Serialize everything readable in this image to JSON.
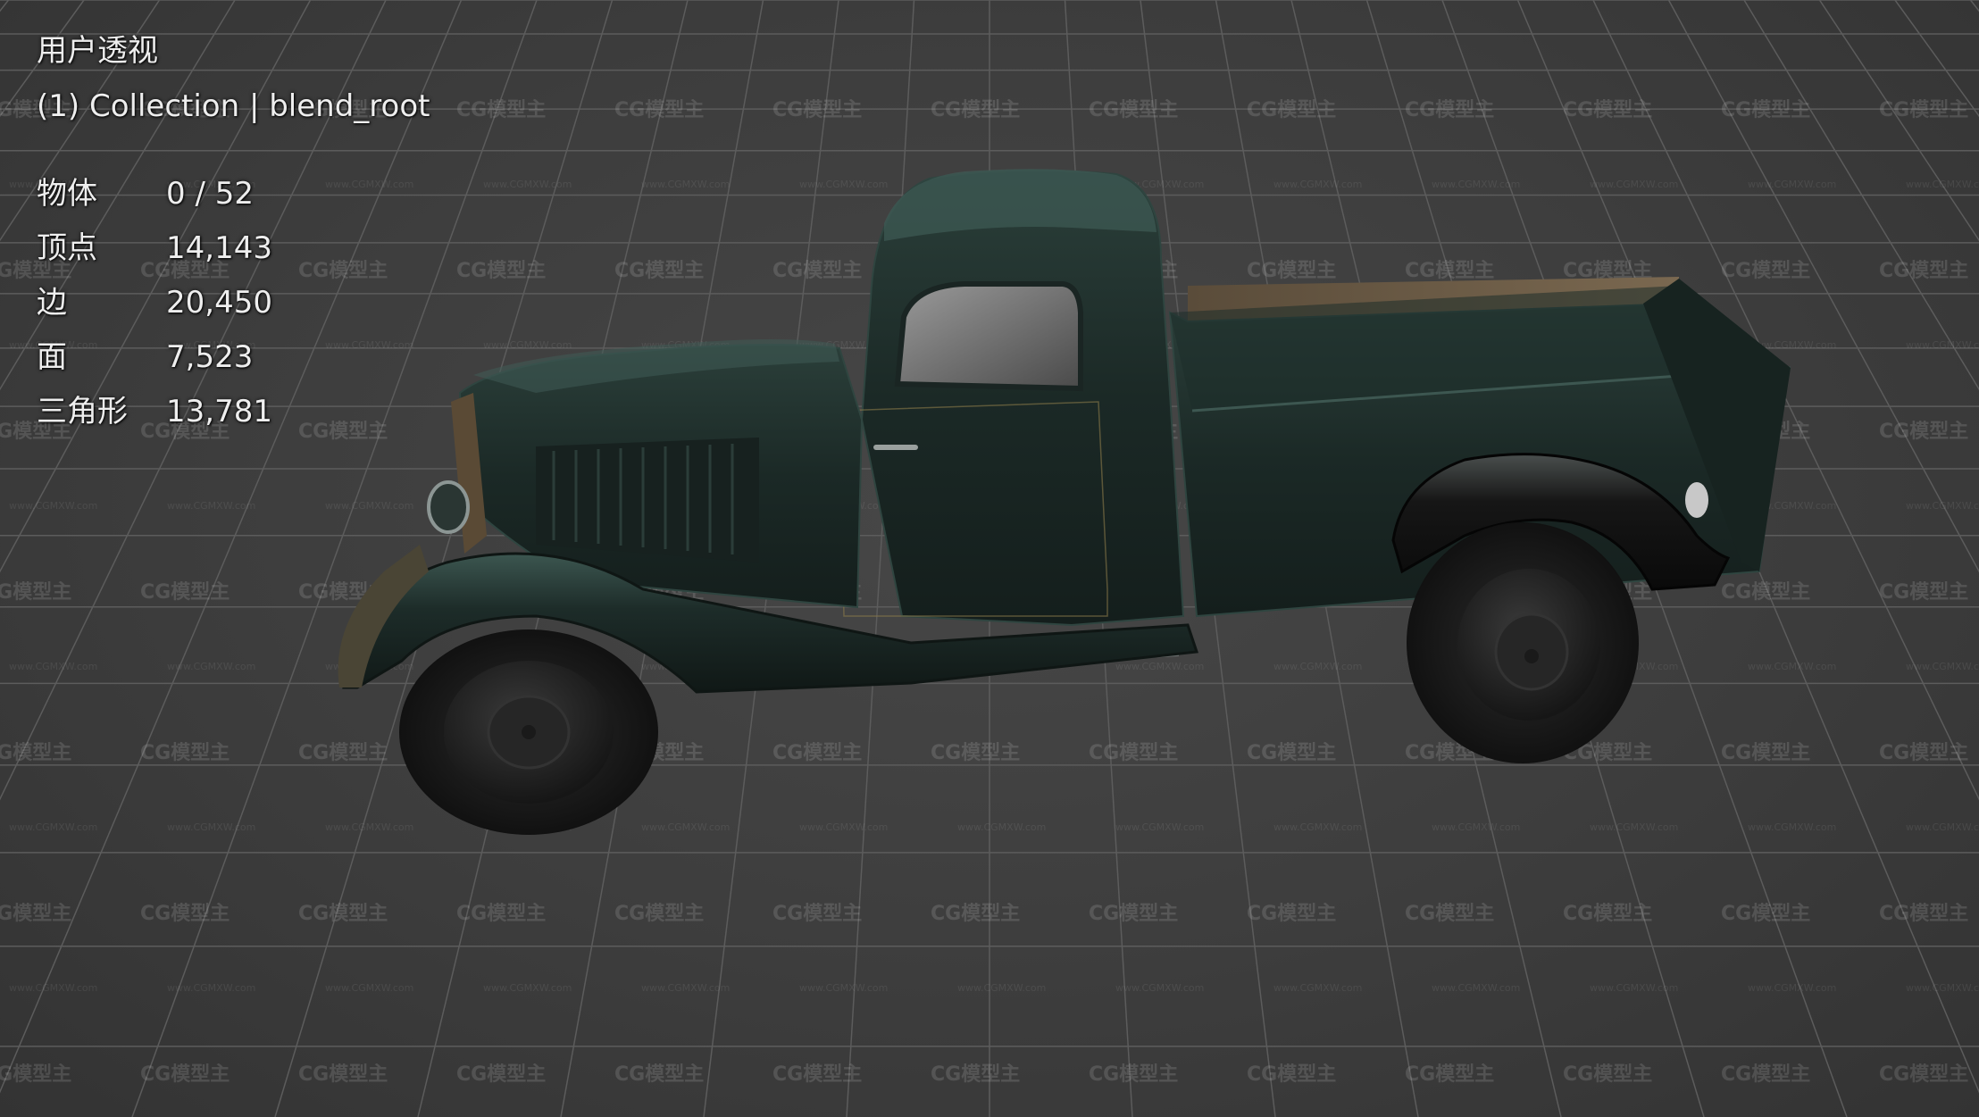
{
  "viewport": {
    "view_name": "用户透视",
    "collection_info": "(1) Collection | blend_root"
  },
  "stats": [
    {
      "label": "物体",
      "value": "0 / 52"
    },
    {
      "label": "顶点",
      "value": "14,143"
    },
    {
      "label": "边",
      "value": "20,450"
    },
    {
      "label": "面",
      "value": "7,523"
    },
    {
      "label": "三角形",
      "value": "13,781"
    }
  ],
  "watermark": {
    "logo": "CG模型主",
    "url": "www.CGMXW.com"
  },
  "colors": {
    "background": "#3d3d3d",
    "grid": "#5c5c5c",
    "truck_body": "#1c2a27",
    "truck_highlight": "#3b5a52",
    "tire": "#1e1e1e",
    "bed_interior": "#6a5a45"
  }
}
